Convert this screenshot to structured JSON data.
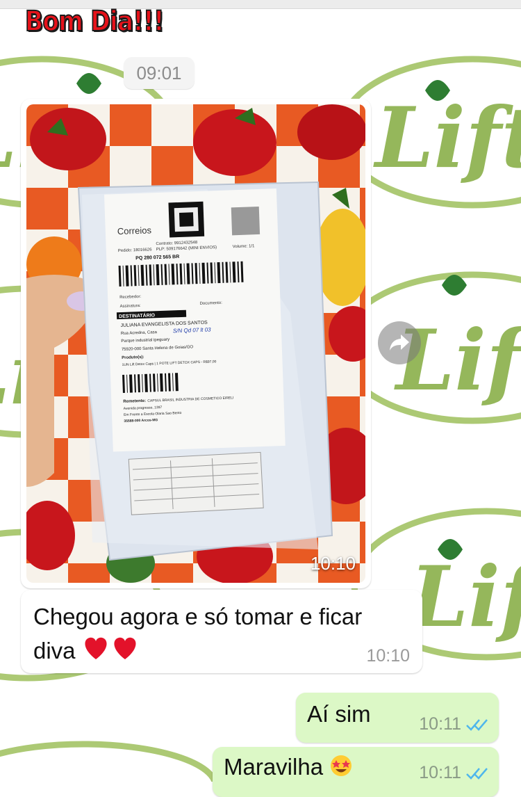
{
  "wallpaper": {
    "logo_text": "Lift",
    "logo_color": "#8ab04a"
  },
  "banner": {
    "text": "Bom Dia!!!"
  },
  "date_chip": {
    "label": "09:01"
  },
  "photo_message": {
    "time": "10:10",
    "package": {
      "brand": "Correios",
      "tracking": "PQ 280 072 565 BR",
      "contract": "Contrato: 9912432548",
      "plp": "PLP: 509176642 (MINI ENVIOS)",
      "pedido": "Pedido: 18016626",
      "volume": "Volume: 1/1",
      "recebedor": "Recebedor:",
      "assinatura": "Assinatura:",
      "documento": "Documento:",
      "dest_header": "DESTINATÁRIO",
      "dest_name": "JULIANA EVANGELISTA DOS SANTOS",
      "dest_street": "Rua Acredna, Casa",
      "dest_handwritten": "S/N Qd 07 lt 03",
      "dest_district": "Parque industrial ipeguary",
      "dest_city": "75920-000 Santa Helena de Goias/GO",
      "produto_label": "Produto(s):",
      "produto": "1UN Lift Detox Caps | 1 POTE LIFT DETOX CAPS - R$97,00",
      "rem_label": "Remetente:",
      "rem_name": "CAPSUL BRASIL INDUSTRIA DE COSMETICO EIRELI",
      "rem_street": "Avenida progresso, 1397",
      "rem_ref": "Em Frente a Escola Olaria Sao Bento",
      "rem_city": "35588-000 Arcos-MG"
    }
  },
  "forward_button": {
    "icon": "forward-arrow-icon"
  },
  "incoming_message": {
    "text": "Chegou agora e só tomar e ficar diva",
    "emojis": "❤️❤️",
    "time": "10:10"
  },
  "outgoing_messages": [
    {
      "text": "Aí sim",
      "time": "10:11",
      "status": "read"
    },
    {
      "text": "Maravilha",
      "emoji": "🤩",
      "time": "10:11",
      "status": "read"
    }
  ],
  "colors": {
    "incoming_bubble": "#ffffff",
    "outgoing_bubble": "#dcf8c6",
    "read_ticks": "#4fb6ec",
    "timestamp": "#9a9a9a"
  }
}
